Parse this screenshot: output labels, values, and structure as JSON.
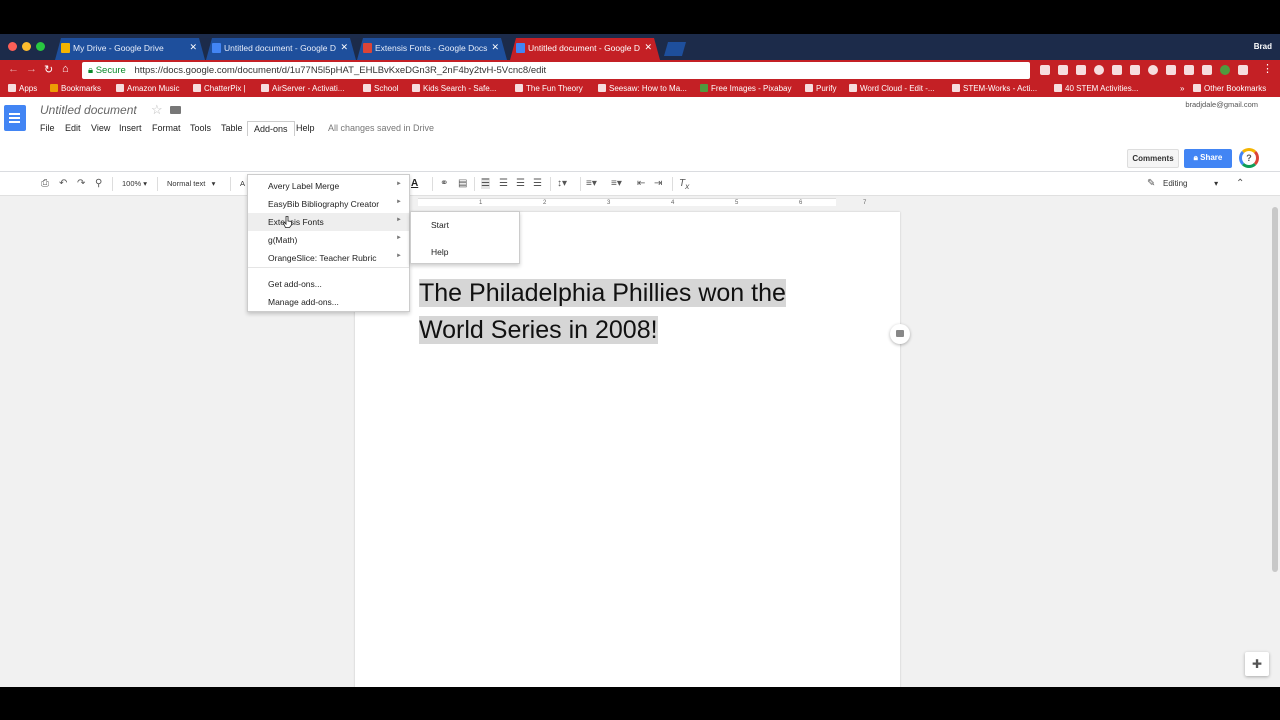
{
  "window": {
    "user": "Brad",
    "tabs": [
      {
        "label": "My Drive - Google Drive",
        "active": false,
        "color": "#f4b400"
      },
      {
        "label": "Untitled document - Google D",
        "active": false,
        "color": "#4285f4"
      },
      {
        "label": "Extensis Fonts - Google Docs",
        "active": false,
        "color": "#db4437"
      },
      {
        "label": "Untitled document - Google D",
        "active": true,
        "color": "#4285f4"
      }
    ]
  },
  "omnibox": {
    "secure_label": "Secure",
    "url": "https://docs.google.com/document/d/1u77N5l5pHAT_EHLBvKxeDGn3R_2nF4by2tvH-5Vcnc8/edit"
  },
  "bookmarks": [
    "Apps",
    "Bookmarks",
    "Amazon Music",
    "ChatterPix |",
    "AirServer - Activati...",
    "School",
    "Kids Search - Safe...",
    "The Fun Theory",
    "Seesaw: How to Ma...",
    "Free Images - Pixabay",
    "Purify",
    "Word Cloud - Edit -...",
    "STEM-Works - Acti...",
    "40 STEM Activities...",
    "»",
    "Other Bookmarks"
  ],
  "docs": {
    "title": "Untitled document",
    "account": "bradjdale@gmail.com",
    "menus": [
      "File",
      "Edit",
      "View",
      "Insert",
      "Format",
      "Tools",
      "Table",
      "Add-ons",
      "Help"
    ],
    "open_menu": "Add-ons",
    "save_status": "All changes saved in Drive",
    "comments_label": "Comments",
    "share_label": "Share",
    "help_glyph": "?",
    "zoom": "100%",
    "style": "Normal text",
    "font_partial": "A",
    "mode": "Editing",
    "body_lines": [
      "The Philadelphia Phillies won the",
      "World Series in 2008!"
    ]
  },
  "ruler_numbers": [
    "1",
    "2",
    "3",
    "4",
    "5",
    "6",
    "7"
  ],
  "addons_menu": {
    "items": [
      {
        "label": "Avery Label Merge",
        "submenu": true
      },
      {
        "label": "EasyBib Bibliography Creator",
        "submenu": true
      },
      {
        "label": "Extensis Fonts",
        "submenu": true,
        "highlighted": true
      },
      {
        "label": "g(Math)",
        "submenu": true
      },
      {
        "label": "OrangeSlice: Teacher Rubric",
        "submenu": true
      }
    ],
    "footer_items": [
      "Get add-ons...",
      "Manage add-ons..."
    ],
    "arrow_glyph": "►"
  },
  "extensis_submenu": [
    "Start",
    "Help"
  ]
}
